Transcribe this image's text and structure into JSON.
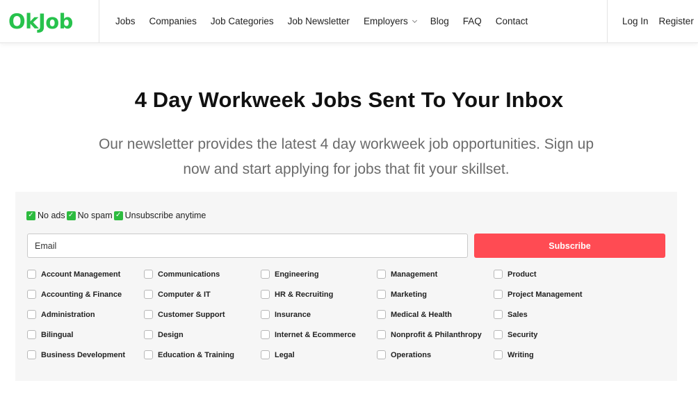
{
  "header": {
    "logo": "OkJob",
    "nav": [
      "Jobs",
      "Companies",
      "Job Categories",
      "Job Newsletter",
      "Employers",
      "Blog",
      "FAQ",
      "Contact"
    ],
    "login": "Log In",
    "register": "Register"
  },
  "hero": {
    "title": "4 Day Workweek Jobs Sent To Your Inbox",
    "subtitle": "Our newsletter provides the latest 4 day workweek job opportunities. Sign up now and start applying for jobs that fit your skillset."
  },
  "form": {
    "perks": [
      "No ads",
      "No spam",
      "Unsubscribe anytime"
    ],
    "email_placeholder": "Email",
    "subscribe_label": "Subscribe",
    "categories": [
      [
        "Account Management",
        "Accounting & Finance",
        "Administration",
        "Bilingual",
        "Business Development"
      ],
      [
        "Communications",
        "Computer & IT",
        "Customer Support",
        "Design",
        "Education & Training"
      ],
      [
        "Engineering",
        "HR & Recruiting",
        "Insurance",
        "Internet & Ecommerce",
        "Legal"
      ],
      [
        "Management",
        "Marketing",
        "Medical & Health",
        "Nonprofit & Philanthropy",
        "Operations"
      ],
      [
        "Product",
        "Project Management",
        "Sales",
        "Security",
        "Writing"
      ]
    ]
  },
  "colors": {
    "brand": "#27c24c",
    "subscribe": "#ff4b53",
    "panel_bg": "#f6f6f6",
    "check": "#2dbb3f"
  }
}
